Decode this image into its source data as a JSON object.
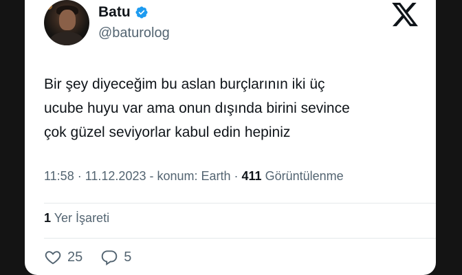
{
  "author": {
    "display_name": "Batu",
    "handle": "@baturolog",
    "verified": true
  },
  "brand": {
    "logo": "x-logo-icon"
  },
  "tweet": {
    "lines": [
      "Bir şey diyeceğim bu aslan burçlarının iki üç",
      "ucube huyu var ama onun dışında birini sevince",
      "çok güzel seviyorlar kabul edin hepiniz"
    ]
  },
  "meta": {
    "time": "11:58",
    "separator1": " · ",
    "date": "11.12.2023",
    "location": " - konum: Earth",
    "separator2": " · ",
    "views_count": "411",
    "views_label": " Görüntülenme"
  },
  "bookmarks": {
    "count": "1",
    "label": " Yer İşareti"
  },
  "actions": {
    "likes": "25",
    "replies": "5"
  },
  "colors": {
    "verified_blue": "#1d9bf0",
    "text_primary": "#0f1419",
    "text_secondary": "#536471"
  }
}
